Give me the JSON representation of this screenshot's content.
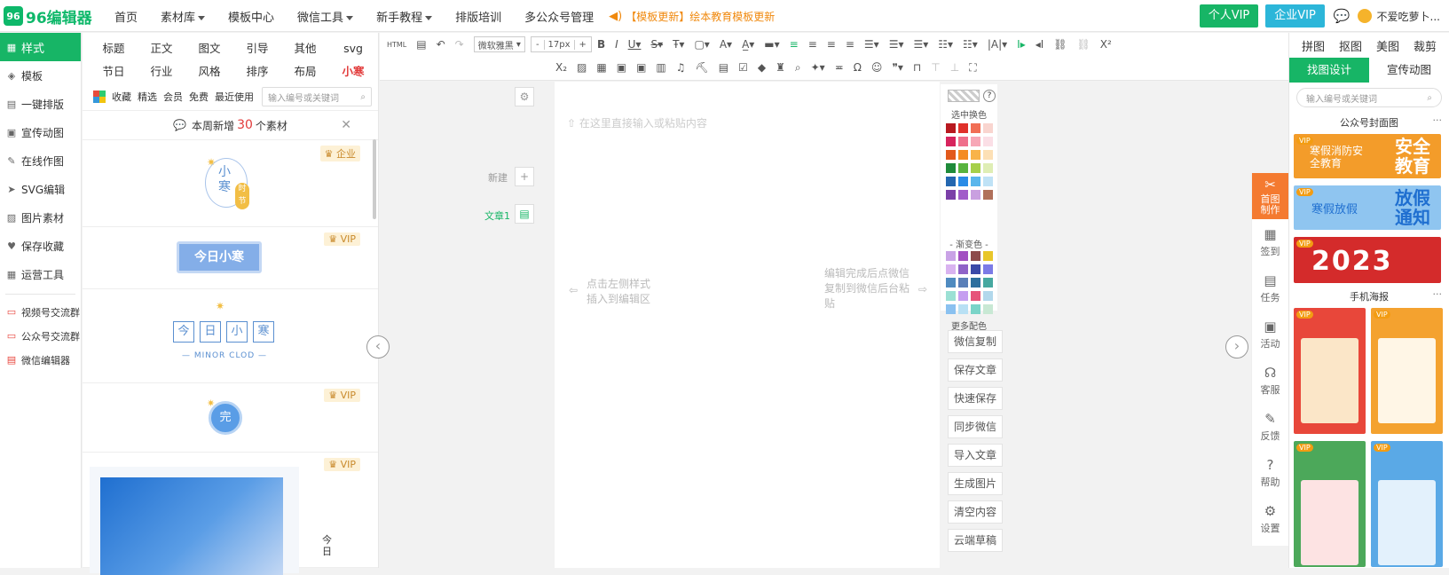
{
  "header": {
    "logo_icon": "96",
    "logo_text": "96编辑器",
    "nav": [
      {
        "label": "首页",
        "dropdown": false
      },
      {
        "label": "素材库",
        "dropdown": true
      },
      {
        "label": "模板中心",
        "dropdown": false
      },
      {
        "label": "微信工具",
        "dropdown": true
      },
      {
        "label": "新手教程",
        "dropdown": true
      },
      {
        "label": "排版培训",
        "dropdown": false
      },
      {
        "label": "多公众号管理",
        "dropdown": false
      }
    ],
    "notice": "【模板更新】绘本教育模板更新",
    "personal_vip": "个人VIP",
    "enterprise_vip": "企业VIP",
    "username": "不爱吃萝卜..."
  },
  "left_sidebar": {
    "items": [
      {
        "label": "样式",
        "icon": "grid-icon",
        "glyph": "▦"
      },
      {
        "label": "模板",
        "icon": "layers-icon",
        "glyph": "◈"
      },
      {
        "label": "一键排版",
        "icon": "format-icon",
        "glyph": "▤"
      },
      {
        "label": "宣传动图",
        "icon": "gif-icon",
        "glyph": "▣"
      },
      {
        "label": "在线作图",
        "icon": "edit-image-icon",
        "glyph": "✎"
      },
      {
        "label": "SVG编辑",
        "icon": "svg-icon",
        "glyph": "➤"
      },
      {
        "label": "图片素材",
        "icon": "image-icon",
        "glyph": "▨"
      },
      {
        "label": "保存收藏",
        "icon": "heart-icon",
        "glyph": "♥"
      },
      {
        "label": "运营工具",
        "icon": "tools-icon",
        "glyph": "▦"
      }
    ],
    "groups": [
      {
        "label": "视频号交流群",
        "icon": "chat-icon",
        "glyph": "▭"
      },
      {
        "label": "公众号交流群",
        "icon": "chat-icon",
        "glyph": "▭"
      },
      {
        "label": "微信编辑器",
        "icon": "doc-icon",
        "glyph": "▤"
      }
    ]
  },
  "categories": [
    "标题",
    "正文",
    "图文",
    "引导",
    "其他",
    "svg",
    "节日",
    "行业",
    "风格",
    "排序",
    "布局",
    "小寒"
  ],
  "filters": [
    "收藏",
    "精选",
    "会员",
    "免费",
    "最近使用"
  ],
  "search_placeholder": "输入编号或关键词",
  "new_bar": {
    "prefix": "本周新增",
    "count": "30",
    "suffix": "个素材"
  },
  "templates": {
    "t1_badge": "企业",
    "t1_big": "小",
    "t1_big2": "寒",
    "t1_small": "时",
    "t1_small2": "节",
    "t2_badge": "VIP",
    "t2_text": "今日小寒",
    "t3_chars": [
      "今",
      "日",
      "小",
      "寒"
    ],
    "t3_sub": "— MINOR CLOD —",
    "t4_badge": "VIP",
    "t4_text": "完",
    "t5_badge": "VIP",
    "t5_side": "今日"
  },
  "editor": {
    "font_select": "微软雅黑",
    "font_size": "17px",
    "minus": "-",
    "plus": "+",
    "placeholder": "在这里直接输入或粘贴内容",
    "new_label": "新建",
    "doc_label": "文章1",
    "hint_left": "点击左侧样式插入到编辑区",
    "hint_right": "编辑完成后点微信复制到微信后台粘贴"
  },
  "color_panel": {
    "selected_label": "选中换色",
    "gradient_label": "- 渐变色 -",
    "more_label": "更多配色",
    "solid_colors": [
      [
        "#b8191f",
        "#e0312b",
        "#f16e55",
        "#f9d5cf"
      ],
      [
        "#d7245d",
        "#ef6f8b",
        "#f7a7b6",
        "#fbdfe6"
      ],
      [
        "#e25a1c",
        "#f48b22",
        "#f8b34a",
        "#fde0b6"
      ],
      [
        "#1f8b3a",
        "#58b33e",
        "#a6d04a",
        "#dfeeb5"
      ],
      [
        "#2467b0",
        "#2a8be6",
        "#5ab6ec",
        "#bfe2f6"
      ],
      [
        "#7b3fa8",
        "#a15dc9",
        "#c9a0e0",
        "#b0705a"
      ]
    ],
    "gradient_colors": [
      [
        "#c9a2e6",
        "#a24fc2",
        "#8d4b4b",
        "#e8c62a"
      ],
      [
        "#d9b3f0",
        "#8f63c8",
        "#3b4aa8",
        "#7b7be6"
      ],
      [
        "#4f8bc0",
        "#5a7fb8",
        "#2d6f9e",
        "#46a8a0"
      ],
      [
        "#9be0d4",
        "#c59ef0",
        "#e6547a",
        "#b2d8ec"
      ],
      [
        "#8ac1f0",
        "#b8e0f4",
        "#7ad4c8",
        "#c8e8d4"
      ]
    ]
  },
  "action_buttons": [
    "微信复制",
    "保存文章",
    "快速保存",
    "同步微信",
    "导入文章",
    "生成图片",
    "清空内容",
    "云端草稿"
  ],
  "right_panel": {
    "tabs": [
      "拼图",
      "抠图",
      "美图",
      "裁剪"
    ],
    "sub_tabs": [
      "找图设计",
      "宣传动图"
    ],
    "search_placeholder": "输入编号或关键词",
    "sections": [
      "公众号封面图",
      "手机海报"
    ],
    "more": "···",
    "covers": [
      {
        "badge": "VIP",
        "title": "安全教育",
        "subtitle": "寒假消防安全教育",
        "color": "#f39c2a"
      },
      {
        "badge": "VIP",
        "title": "放假通知",
        "subtitle": "寒假放假",
        "color": "#5aa9e6"
      },
      {
        "badge": "VIP",
        "title": "2023",
        "subtitle": "",
        "color": "#d42b2b"
      }
    ],
    "posters": [
      {
        "badge": "VIP",
        "color": "#e8473a"
      },
      {
        "badge": "VIP",
        "color": "#f4a22f"
      },
      {
        "badge": "VIP",
        "color": "#4ca85a"
      },
      {
        "badge": "VIP",
        "color": "#5aa9e6"
      }
    ]
  },
  "vertical_strip": [
    {
      "label": "首图制作",
      "icon": "scissors-icon",
      "glyph": "✂"
    },
    {
      "label": "签到",
      "icon": "calendar-icon",
      "glyph": "▦"
    },
    {
      "label": "任务",
      "icon": "task-icon",
      "glyph": "▤"
    },
    {
      "label": "活动",
      "icon": "gift-icon",
      "glyph": "▣"
    },
    {
      "label": "客服",
      "icon": "headset-icon",
      "glyph": "☊"
    },
    {
      "label": "反馈",
      "icon": "feedback-icon",
      "glyph": "✎"
    },
    {
      "label": "帮助",
      "icon": "help-icon",
      "glyph": "?"
    },
    {
      "label": "设置",
      "icon": "gear-icon",
      "glyph": "⚙"
    }
  ]
}
